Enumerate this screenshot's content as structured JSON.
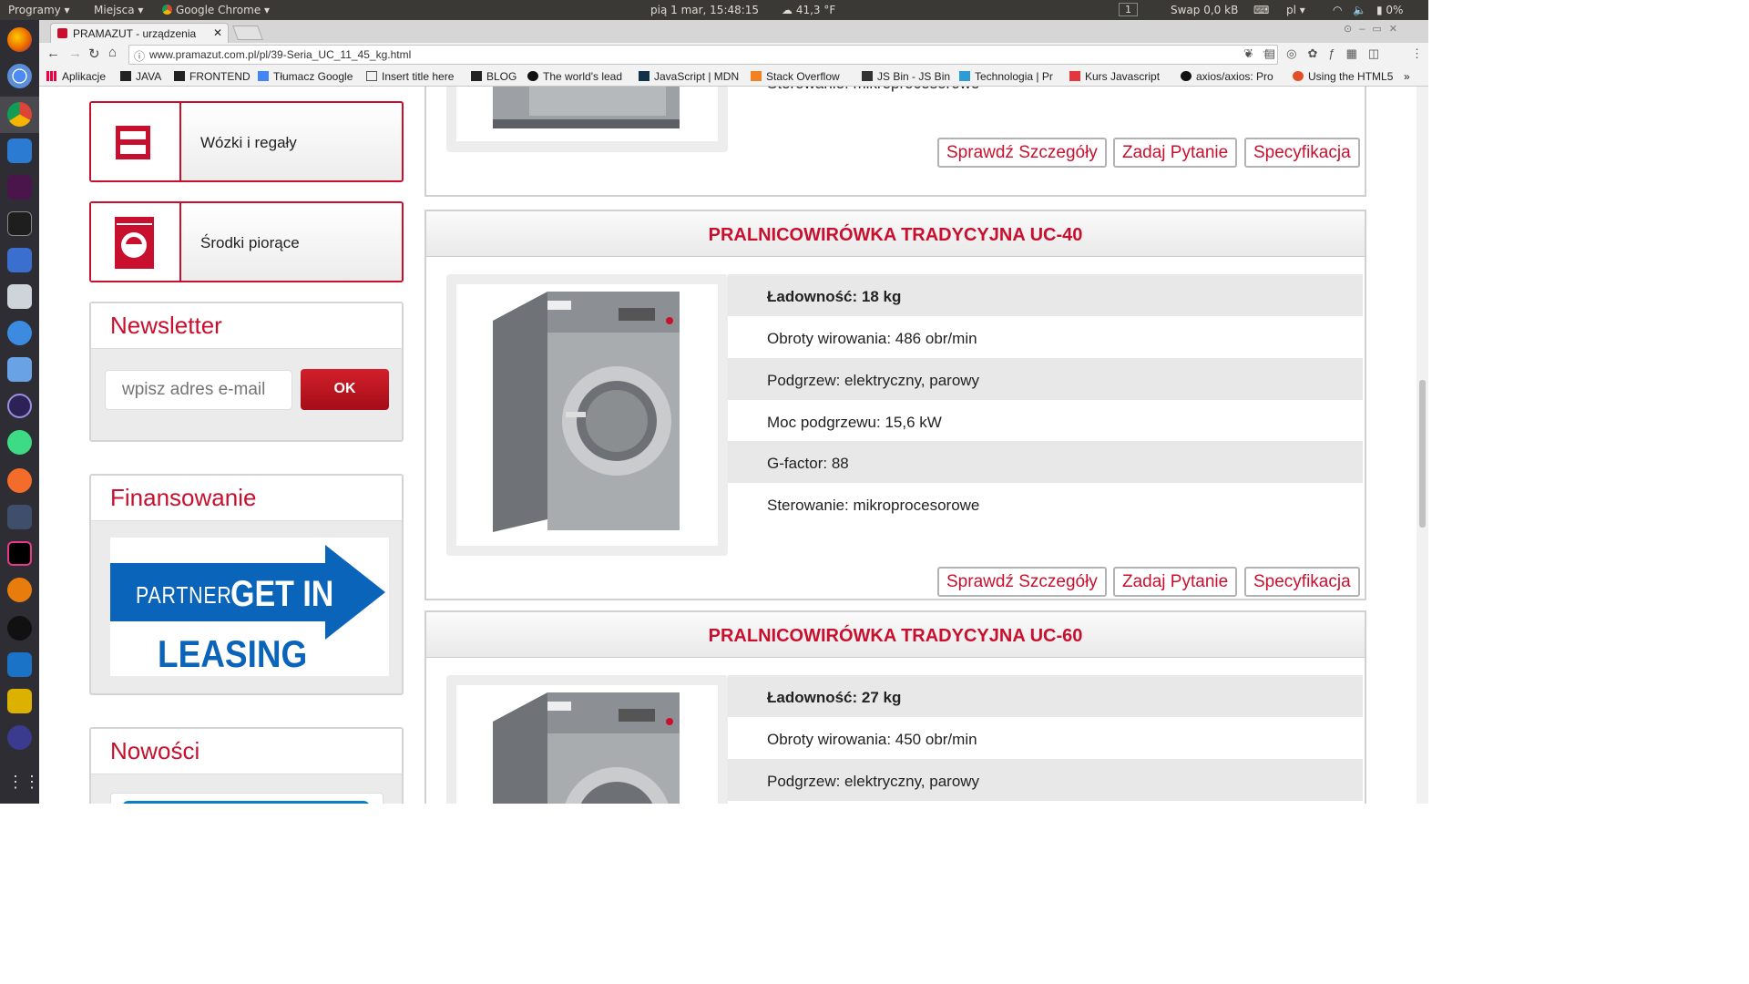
{
  "system_bar": {
    "programs": "Programy ▾",
    "places": "Miejsca ▾",
    "app": "Google Chrome ▾",
    "clock": "pią 1 mar, 15:48:15",
    "weather": "41,3 °F",
    "workspace": "1",
    "swap": "Swap 0,0 kB",
    "lang": "pl ▾",
    "battery": "0%"
  },
  "browser": {
    "tab_title": "PRAMAZUT - urządzenia",
    "url": "www.pramazut.com.pl/pl/39-Seria_UC_11_45_kg.html",
    "bookmarks": [
      "Aplikacje",
      "JAVA",
      "FRONTEND",
      "Tłumacz Google",
      "Insert title here",
      "BLOG",
      "The world's lead",
      "JavaScript | MDN",
      "Stack Overflow",
      "JS Bin - JS Bin",
      "Technologia | Pr",
      "Kurs Javascript",
      "axios/axios: Pro",
      "Using the HTML5"
    ],
    "more": "»"
  },
  "sidebar": {
    "category_carts": "Wózki i regały",
    "category_detergents": "Środki piorące",
    "newsletter_title": "Newsletter",
    "email_placeholder": "wpisz adres e-mail",
    "ok_label": "OK",
    "financing_title": "Finansowanie",
    "leasing_partner": "PARTNER",
    "leasing_get_in": "GET IN",
    "leasing_word": "LEASING",
    "news_title": "Nowości"
  },
  "products": [
    {
      "title": "",
      "specs": [
        "Sterowanie: mikroprocesorowe"
      ],
      "buttons": [
        "Sprawdź Szczegóły",
        "Zadaj Pytanie",
        "Specyfikacja"
      ]
    },
    {
      "title": "PRALNICOWIRÓWKA TRADYCYJNA UC-40",
      "specs": [
        "Ładowność: 18 kg",
        "Obroty wirowania: 486 obr/min",
        "Podgrzew: elektryczny, parowy",
        "Moc podgrzewu: 15,6 kW",
        "G-factor: 88",
        "Sterowanie: mikroprocesorowe"
      ],
      "buttons": [
        "Sprawdź Szczegóły",
        "Zadaj Pytanie",
        "Specyfikacja"
      ]
    },
    {
      "title": "PRALNICOWIRÓWKA TRADYCYJNA UC-60",
      "specs": [
        "Ładowność: 27 kg",
        "Obroty wirowania: 450 obr/min",
        "Podgrzew: elektryczny, parowy"
      ]
    }
  ],
  "colors": {
    "brand_red": "#c8102e",
    "leasing_blue": "#0a64b9"
  }
}
